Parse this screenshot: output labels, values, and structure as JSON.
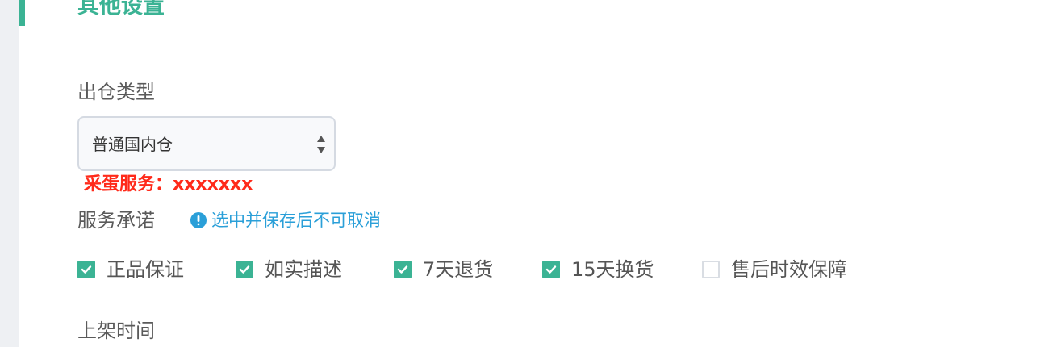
{
  "section": {
    "title": "其他设置"
  },
  "outbound": {
    "label": "出仓类型",
    "selected": "普通国内仓"
  },
  "annotation": {
    "text": "采蛋服务：xxxxxxx"
  },
  "service": {
    "label": "服务承诺",
    "hint_icon": "info-circle-icon",
    "hint": "选中并保存后不可取消",
    "options": [
      {
        "label": "正品保证",
        "checked": true
      },
      {
        "label": "如实描述",
        "checked": true
      },
      {
        "label": "7天退货",
        "checked": true
      },
      {
        "label": "15天换货",
        "checked": true
      },
      {
        "label": "售后时效保障",
        "checked": false
      }
    ]
  },
  "shelf": {
    "label": "上架时间"
  },
  "colors": {
    "accent": "#3bb394",
    "hint": "#2a9fd8",
    "annotation": "#ff2a1a"
  }
}
